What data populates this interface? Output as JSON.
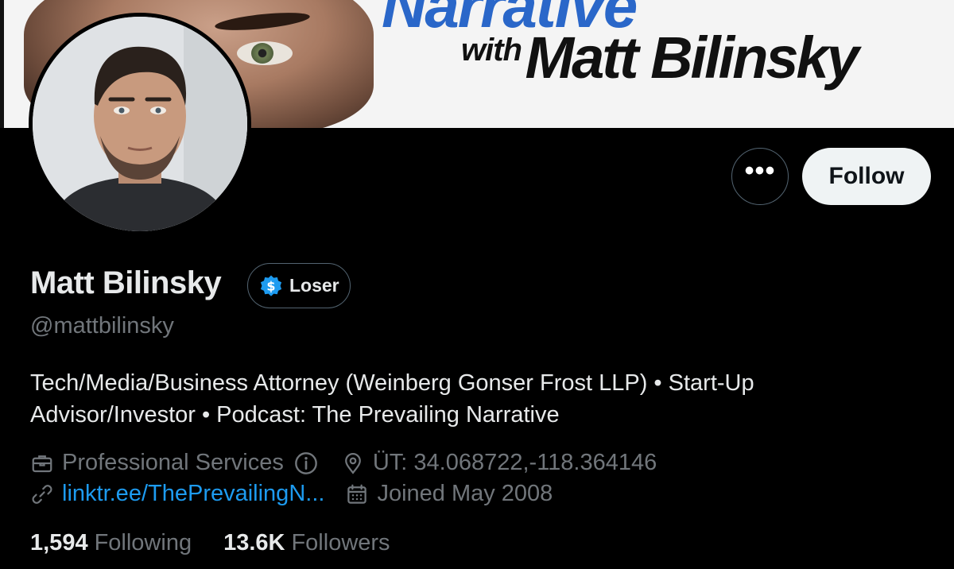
{
  "banner": {
    "headline_partial": "Narrative",
    "with_text": "with",
    "host_name": "Matt Bilinsky"
  },
  "profile": {
    "display_name": "Matt Bilinsky",
    "label_badge": "Loser",
    "handle": "@mattbilinsky",
    "bio_line1": "Tech/Media/Business Attorney (Weinberg Gonser Frost LLP) • Start-Up",
    "bio_line2": "Advisor/Investor • Podcast: The Prevailing Narrative",
    "category": "Professional Services",
    "location": "ÜT: 34.068722,-118.364146",
    "link": "linktr.ee/ThePrevailingN...",
    "joined": "Joined May 2008",
    "following_count": "1,594",
    "following_label": "Following",
    "followers_count": "13.6K",
    "followers_label": "Followers"
  },
  "actions": {
    "more_label": "•••",
    "follow_label": "Follow"
  },
  "icons": {
    "more": "more-horizontal-icon",
    "badge": "dollar-badge-icon",
    "category": "briefcase-icon",
    "info": "info-icon",
    "location": "location-pin-icon",
    "link": "link-icon",
    "joined": "calendar-icon"
  },
  "colors": {
    "background": "#000000",
    "primary_text": "#e7e9ea",
    "secondary_text": "#71767b",
    "link": "#1d9bf0",
    "follow_button_bg": "#eff3f4",
    "badge_blue": "#1d9bf0",
    "banner_headline": "#2a67c9"
  }
}
